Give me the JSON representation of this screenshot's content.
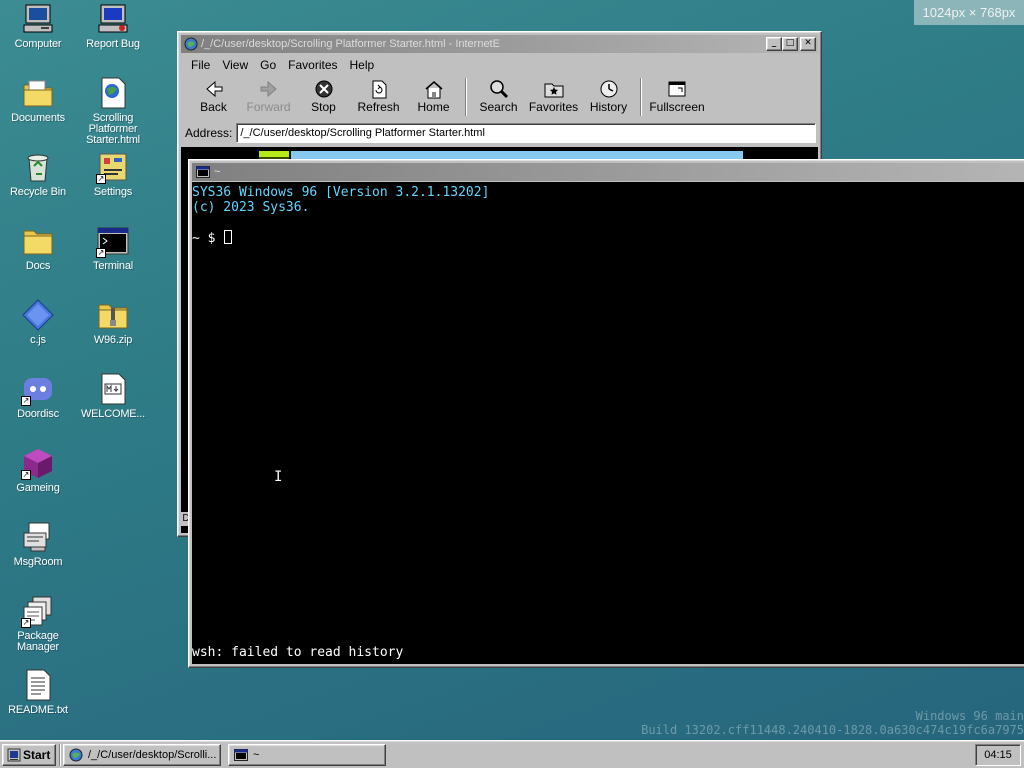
{
  "screen": {
    "size_badge": "1024px × 768px"
  },
  "desktop": {
    "icons": [
      {
        "id": "computer",
        "label": "Computer"
      },
      {
        "id": "report-bug",
        "label": "Report Bug"
      },
      {
        "id": "documents",
        "label": "Documents"
      },
      {
        "id": "scrolling-platformer",
        "label": "Scrolling Platformer Starter.html"
      },
      {
        "id": "recycle-bin",
        "label": "Recycle Bin"
      },
      {
        "id": "settings",
        "label": "Settings"
      },
      {
        "id": "docs",
        "label": "Docs"
      },
      {
        "id": "terminal",
        "label": "Terminal"
      },
      {
        "id": "cjs",
        "label": "c.js"
      },
      {
        "id": "w96zip",
        "label": "W96.zip"
      },
      {
        "id": "doordisc",
        "label": "Doordisc"
      },
      {
        "id": "welcome",
        "label": "WELCOME..."
      },
      {
        "id": "gameing",
        "label": "Gameing"
      },
      {
        "id": "msgroom",
        "label": "MsgRoom"
      },
      {
        "id": "package-manager",
        "label": "Package Manager"
      },
      {
        "id": "readme",
        "label": "README.txt"
      }
    ],
    "watermark": {
      "line1": "Windows 96 main",
      "line2": "Build 13202.cff11448.240410-1828.0a630c474c19fc6a7975"
    }
  },
  "browser": {
    "title": "/_/C/user/desktop/Scrolling Platformer Starter.html - InternetE",
    "menu": [
      "File",
      "View",
      "Go",
      "Favorites",
      "Help"
    ],
    "toolbar": {
      "back": "Back",
      "forward": "Forward",
      "stop": "Stop",
      "refresh": "Refresh",
      "home": "Home",
      "search": "Search",
      "favorites": "Favorites",
      "history": "History",
      "fullscreen": "Fullscreen"
    },
    "address_label": "Address:",
    "address_value": "/_/C/user/desktop/Scrolling Platformer Starter.html",
    "partial_char": "D",
    "window_buttons": {
      "minimize": "_",
      "maximize": "□",
      "close": "✕"
    }
  },
  "terminal": {
    "title": "~",
    "lines": {
      "version": "SYS36 Windows 96 [Version 3.2.1.13202]",
      "copyright": "(c) 2023 Sys36.",
      "prompt": "~ $ "
    },
    "status": "wsh: failed to read history",
    "ibeam": "I"
  },
  "taskbar": {
    "start_label": "Start",
    "tasks": [
      {
        "label": "/_/C/user/desktop/Scrolli..."
      },
      {
        "label": "~"
      }
    ],
    "clock": "04:15"
  }
}
